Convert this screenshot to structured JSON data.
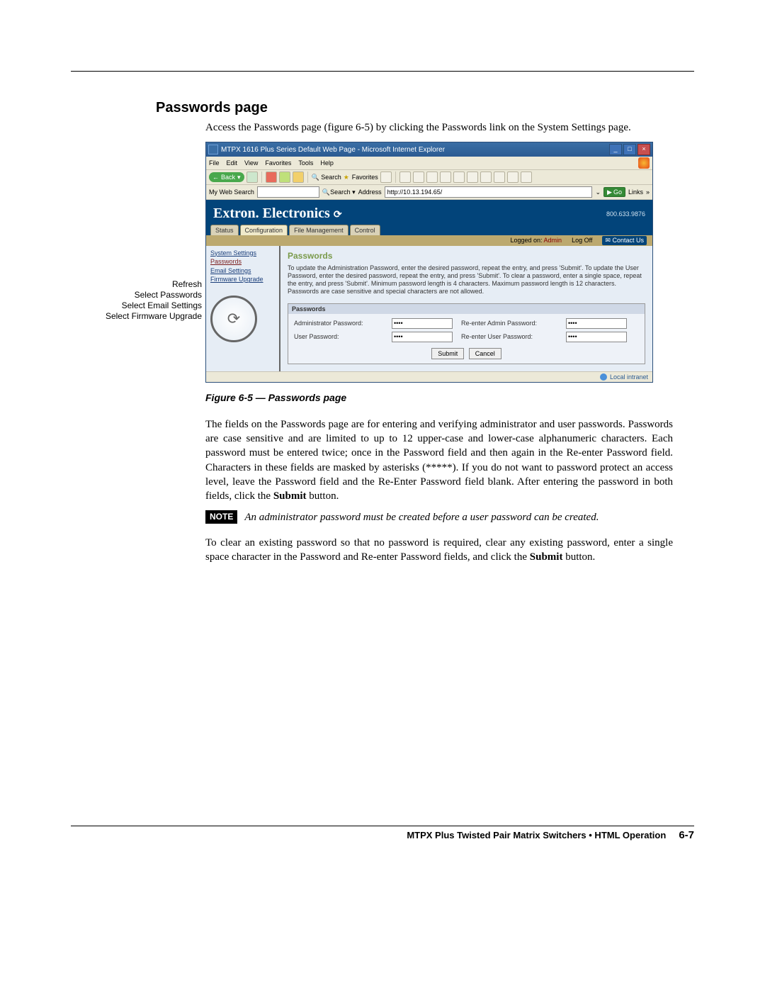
{
  "heading": "Passwords page",
  "intro": "Access the Passwords page (figure 6-5) by clicking the Passwords link on the System Settings page.",
  "callouts": {
    "refresh": "Refresh",
    "passwords": "Select Passwords",
    "email": "Select Email Settings",
    "firmware": "Select Firmware Upgrade"
  },
  "ie": {
    "title": "MTPX 1616 Plus Series Default Web Page - Microsoft Internet Explorer",
    "menus": [
      "File",
      "Edit",
      "View",
      "Favorites",
      "Tools",
      "Help"
    ],
    "back": "Back",
    "search": "Search",
    "favorites": "Favorites",
    "mywebsearch_label": "My Web Search",
    "search_btn": "Search",
    "address_label": "Address",
    "address_value": "http://10.13.194.65/",
    "go": "Go",
    "links": "Links",
    "status": "Local intranet"
  },
  "extron": {
    "brand": "Extron. Electronics",
    "phone": "800.633.9876",
    "tabs": [
      "Status",
      "Configuration",
      "File Management",
      "Control"
    ],
    "logged_on": "Logged on:",
    "admin": "Admin",
    "logoff": "Log Off",
    "contact": "Contact Us",
    "side": {
      "system": "System Settings",
      "passwords": "Passwords",
      "email": "Email Settings",
      "firmware": "Firmware Upgrade"
    },
    "panel_title": "Passwords",
    "panel_help": "To update the Administration Password, enter the desired password, repeat the entry, and press 'Submit'.  To update the User Password, enter the desired password, repeat the entry, and press 'Submit'.  To clear a password, enter a single space, repeat the entry, and press 'Submit'.  Minimum password length is 4 characters. Maximum password length is 12 characters. Passwords are case sensitive and special characters are not allowed.",
    "box_title": "Passwords",
    "admin_label": "Administrator Password:",
    "re_admin_label": "Re-enter Admin Password:",
    "user_label": "User Password:",
    "re_user_label": "Re-enter User Password:",
    "masked": "••••",
    "submit": "Submit",
    "cancel": "Cancel"
  },
  "figure_caption": "Figure 6-5 — Passwords page",
  "para1_a": "The fields on the Passwords page are for entering and verifying administrator and user passwords.  Passwords are case sensitive and are limited to up to 12 upper-case and lower-case alphanumeric characters.  Each password must be entered twice; once in the Password field and then again in the Re-enter Password field.  Characters in these fields are masked by asterisks (*****).  If you do not want to password protect an access level, leave the Password field and the Re-Enter Password field blank.  After entering the password in both fields, click the ",
  "para1_b": "Submit",
  "para1_c": " button.",
  "note_label": "NOTE",
  "note_text": "An administrator password must be created before a user password can be created.",
  "para2_a": "To clear an existing password so that no password is required, clear any existing password, enter a single space character in the Password and Re-enter Password fields, and click the ",
  "para2_b": "Submit",
  "para2_c": " button.",
  "footer_text": "MTPX Plus Twisted Pair Matrix Switchers • HTML Operation",
  "footer_page": "6-7"
}
